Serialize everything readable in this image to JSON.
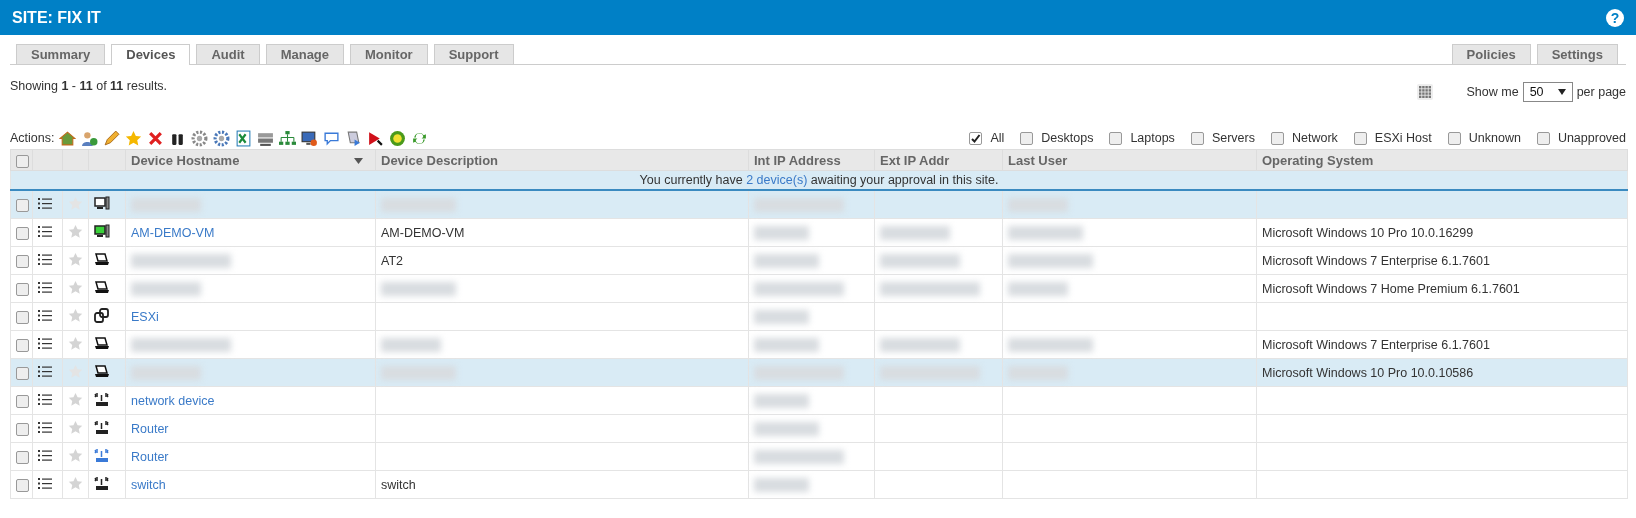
{
  "header": {
    "title": "SITE: FIX IT",
    "help": "?"
  },
  "tabs": [
    {
      "label": "Summary",
      "selected": false
    },
    {
      "label": "Devices",
      "selected": true
    },
    {
      "label": "Audit",
      "selected": false
    },
    {
      "label": "Manage",
      "selected": false
    },
    {
      "label": "Monitor",
      "selected": false
    },
    {
      "label": "Support",
      "selected": false
    }
  ],
  "right_tabs": [
    {
      "label": "Policies",
      "selected": false
    },
    {
      "label": "Settings",
      "selected": false
    }
  ],
  "summary": "Showing **1** - **11** of **11** results.",
  "paging": {
    "label": "Show me",
    "value": "50",
    "suffix": "per page"
  },
  "actions_label": "Actions:",
  "filters": [
    {
      "label": "All",
      "checked": true
    },
    {
      "label": "Desktops",
      "checked": false
    },
    {
      "label": "Laptops",
      "checked": false
    },
    {
      "label": "Servers",
      "checked": false
    },
    {
      "label": "Network",
      "checked": false
    },
    {
      "label": "ESXi Host",
      "checked": false
    },
    {
      "label": "Unknown",
      "checked": false
    },
    {
      "label": "Unapproved",
      "checked": false
    }
  ],
  "table": {
    "select_all_checked": false,
    "columns": [
      "Device Hostname",
      "Device Description",
      "Int IP Address",
      "Ext IP Addr",
      "Last User",
      "Operating System"
    ],
    "notice": {
      "before": "You currently have",
      "link": "2 device(s)",
      "after": "awaiting your approval in this site."
    },
    "rows": [
      {
        "kind": "desktop",
        "highlighted": true,
        "checked": false,
        "cells": [
          {
            "redacted": true
          },
          {
            "redacted": true
          },
          {
            "redacted": true
          },
          {
            "redacted": false
          },
          {
            "redacted": true
          },
          {
            "redacted": false
          }
        ]
      },
      {
        "kind": "vm",
        "highlighted": false,
        "checked": false,
        "cells": [
          {
            "text": "AM-DEMO-VM",
            "redacted": false
          },
          {
            "text": "AM-DEMO-VM",
            "redacted": false
          },
          {
            "redacted": true
          },
          {
            "redacted": true
          },
          {
            "redacted": true
          },
          {
            "text": "Microsoft Windows 10 Pro 10.0.16299",
            "redacted": false
          }
        ]
      },
      {
        "kind": "laptop",
        "highlighted": false,
        "checked": false,
        "cells": [
          {
            "redacted": true
          },
          {
            "text": "AT2",
            "redacted": false
          },
          {
            "redacted": true
          },
          {
            "redacted": true
          },
          {
            "redacted": true
          },
          {
            "text": "Microsoft Windows 7 Enterprise 6.1.7601",
            "redacted": false
          }
        ]
      },
      {
        "kind": "laptop",
        "highlighted": false,
        "checked": false,
        "cells": [
          {
            "redacted": true
          },
          {
            "redacted": true
          },
          {
            "redacted": true
          },
          {
            "redacted": true
          },
          {
            "redacted": true
          },
          {
            "text": "Microsoft Windows 7 Home Premium 6.1.7601",
            "redacted": false
          }
        ]
      },
      {
        "kind": "esxi",
        "highlighted": false,
        "checked": false,
        "cells": [
          {
            "text": "ESXi",
            "redacted": false
          },
          {
            "redacted": false
          },
          {
            "redacted": true
          },
          {
            "redacted": false
          },
          {
            "redacted": false
          },
          {
            "redacted": false
          }
        ]
      },
      {
        "kind": "laptop",
        "highlighted": false,
        "checked": false,
        "cells": [
          {
            "redacted": true
          },
          {
            "redacted": true
          },
          {
            "redacted": true
          },
          {
            "redacted": true
          },
          {
            "redacted": true
          },
          {
            "text": "Microsoft Windows 7 Enterprise 6.1.7601",
            "redacted": false
          }
        ]
      },
      {
        "kind": "laptop",
        "highlighted": true,
        "checked": false,
        "cells": [
          {
            "redacted": true
          },
          {
            "redacted": true
          },
          {
            "redacted": true
          },
          {
            "redacted": true
          },
          {
            "redacted": true
          },
          {
            "text": "Microsoft Windows 10 Pro 10.0.10586",
            "redacted": false
          }
        ]
      },
      {
        "kind": "network",
        "highlighted": false,
        "icon_active": false,
        "checked": false,
        "cells": [
          {
            "text": "network device",
            "redacted": false
          },
          {
            "redacted": false
          },
          {
            "redacted": true
          },
          {
            "redacted": false
          },
          {
            "redacted": false
          },
          {
            "redacted": false
          }
        ]
      },
      {
        "kind": "network",
        "highlighted": false,
        "icon_active": false,
        "checked": false,
        "cells": [
          {
            "text": "Router",
            "redacted": false
          },
          {
            "redacted": false
          },
          {
            "redacted": true
          },
          {
            "redacted": false
          },
          {
            "redacted": false
          },
          {
            "redacted": false
          }
        ]
      },
      {
        "kind": "network",
        "highlighted": false,
        "icon_active": true,
        "checked": false,
        "cells": [
          {
            "text": "Router",
            "redacted": false
          },
          {
            "redacted": false
          },
          {
            "redacted": true
          },
          {
            "redacted": false
          },
          {
            "redacted": false
          },
          {
            "redacted": false
          }
        ]
      },
      {
        "kind": "network",
        "highlighted": false,
        "icon_active": false,
        "checked": false,
        "cells": [
          {
            "text": "switch",
            "redacted": false
          },
          {
            "text": "switch",
            "redacted": false
          },
          {
            "redacted": true
          },
          {
            "redacted": false
          },
          {
            "redacted": false
          },
          {
            "redacted": false
          }
        ]
      }
    ]
  }
}
